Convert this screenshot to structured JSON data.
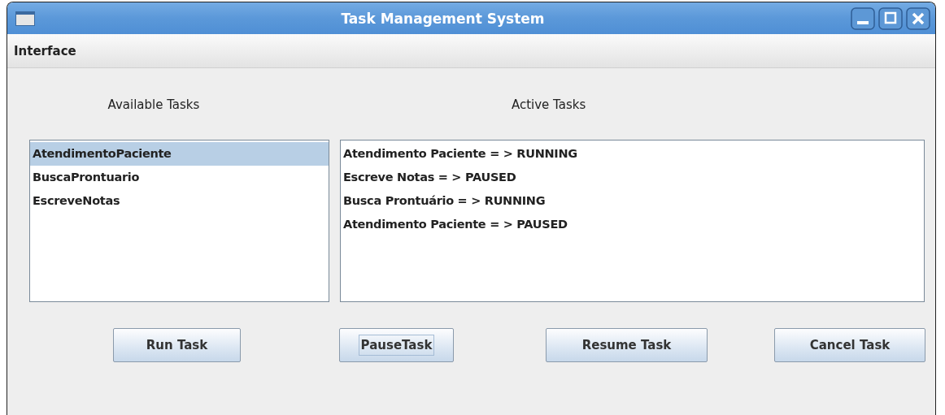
{
  "window": {
    "title": "Task Management System"
  },
  "menu_bar": {
    "items": [
      "Interface"
    ]
  },
  "available_tasks": {
    "title": "Available Tasks",
    "items": [
      {
        "label": "AtendimentoPaciente",
        "selected": true
      },
      {
        "label": "BuscaProntuario",
        "selected": false
      },
      {
        "label": "EscreveNotas",
        "selected": false
      }
    ]
  },
  "active_tasks": {
    "title": "Active Tasks",
    "items": [
      {
        "label": "Atendimento Paciente = > RUNNING",
        "selected": false
      },
      {
        "label": "Escreve Notas = > PAUSED",
        "selected": false
      },
      {
        "label": "Busca Prontuário = > RUNNING",
        "selected": false
      },
      {
        "label": "Atendimento Paciente = > PAUSED",
        "selected": false
      }
    ]
  },
  "buttons": [
    {
      "label": "Run Task",
      "focused": false
    },
    {
      "label": "PauseTask",
      "focused": true
    },
    {
      "label": "Resume Task",
      "focused": false
    },
    {
      "label": "Cancel Task",
      "focused": false
    }
  ]
}
